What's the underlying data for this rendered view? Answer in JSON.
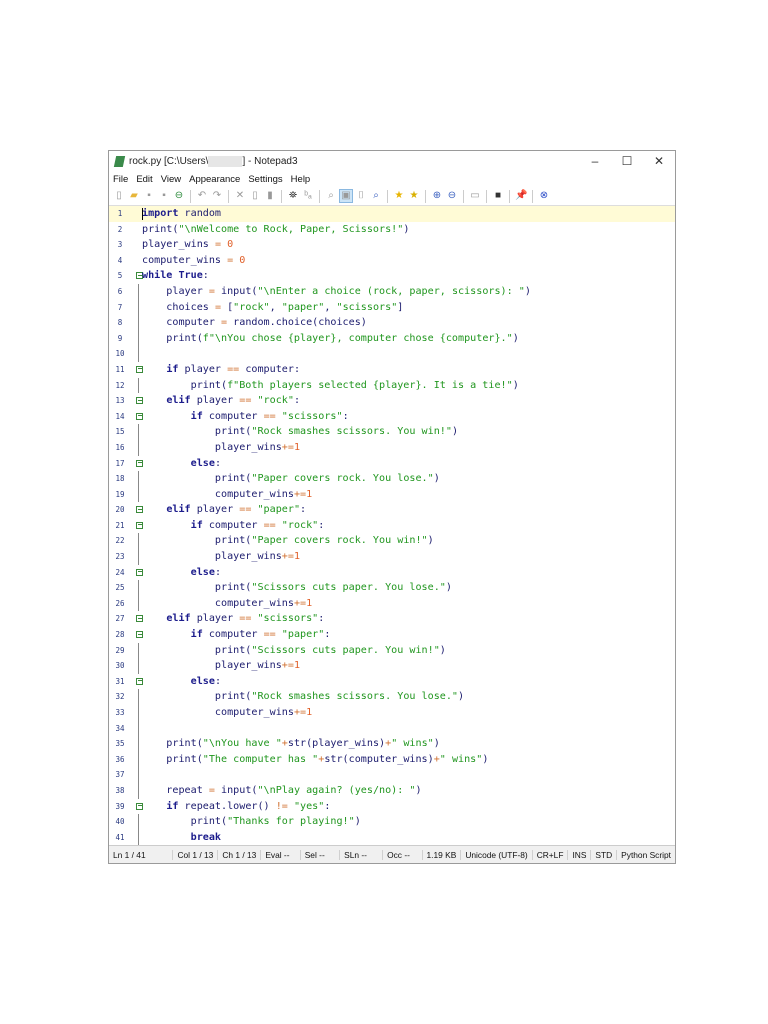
{
  "window": {
    "title_prefix": "rock.py [C:\\Users\\",
    "title_suffix": "] - Notepad3",
    "minimize": "–",
    "maximize": "☐",
    "close": "✕"
  },
  "menu": [
    "File",
    "Edit",
    "View",
    "Appearance",
    "Settings",
    "Help"
  ],
  "toolbar_icons": [
    "new-file-icon",
    "open-folder-icon",
    "save-icon",
    "save-as-icon",
    "revert-icon",
    "|",
    "undo-icon",
    "redo-icon",
    "|",
    "cut-icon",
    "copy-icon",
    "paste-icon",
    "|",
    "find-icon",
    "replace-icon",
    "|",
    "goto-icon",
    "word-wrap-icon",
    "long-line-icon",
    "find-next-icon",
    "|",
    "bookmark-icon",
    "bookmark-add-icon",
    "|",
    "zoom-in-icon",
    "zoom-out-icon",
    "|",
    "view-icon",
    "|",
    "screen-icon",
    "|",
    "pin-icon",
    "|",
    "close-doc-icon"
  ],
  "code_lines": [
    "import random",
    "print(\"\\nWelcome to Rock, Paper, Scissors!\")",
    "player_wins = 0",
    "computer_wins = 0",
    "while True:",
    "    player = input(\"\\nEnter a choice (rock, paper, scissors): \")",
    "    choices = [\"rock\", \"paper\", \"scissors\"]",
    "    computer = random.choice(choices)",
    "    print(f\"\\nYou chose {player}, computer chose {computer}.\")",
    "",
    "    if player == computer:",
    "        print(f\"Both players selected {player}. It is a tie!\")",
    "    elif player == \"rock\":",
    "        if computer == \"scissors\":",
    "            print(\"Rock smashes scissors. You win!\")",
    "            player_wins+=1",
    "        else:",
    "            print(\"Paper covers rock. You lose.\")",
    "            computer_wins+=1",
    "    elif player == \"paper\":",
    "        if computer == \"rock\":",
    "            print(\"Paper covers rock. You win!\")",
    "            player_wins+=1",
    "        else:",
    "            print(\"Scissors cuts paper. You lose.\")",
    "            computer_wins+=1",
    "    elif player == \"scissors\":",
    "        if computer == \"paper\":",
    "            print(\"Scissors cuts paper. You win!\")",
    "            player_wins+=1",
    "        else:",
    "            print(\"Rock smashes scissors. You lose.\")",
    "            computer_wins+=1",
    "",
    "    print(\"\\nYou have \"+str(player_wins)+\" wins\")",
    "    print(\"The computer has \"+str(computer_wins)+\" wins\")",
    "",
    "    repeat = input(\"\\nPlay again? (yes/no): \")",
    "    if repeat.lower() != \"yes\":",
    "        print(\"Thanks for playing!\")",
    "        break"
  ],
  "fold_boxes": [
    5,
    11,
    13,
    14,
    17,
    20,
    21,
    24,
    27,
    28,
    31,
    39
  ],
  "status": {
    "ln": "Ln 1 / 41",
    "col": "Col 1 / 13",
    "ch": "Ch 1 / 13",
    "eval": "Eval --",
    "sel": "Sel --",
    "sln": "SLn --",
    "occ": "Occ --",
    "size": "1.19 KB",
    "encoding": "Unicode (UTF-8)",
    "eol": "CR+LF",
    "ins": "INS",
    "std": "STD",
    "lexer": "Python Script"
  }
}
